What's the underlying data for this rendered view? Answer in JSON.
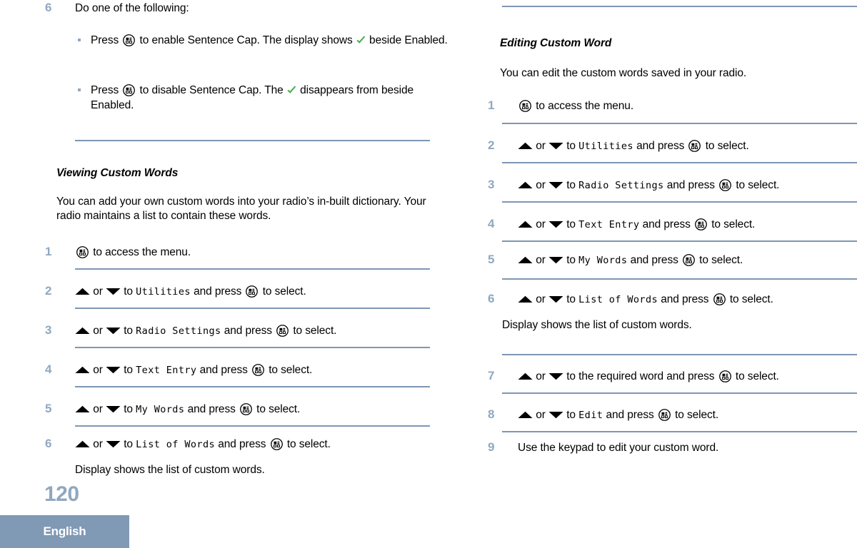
{
  "page": {
    "number": "120",
    "language": "English"
  },
  "icons": {
    "menu_button": "menu-button-icon",
    "up_arrow": "up-arrow-icon",
    "down_arrow": "down-arrow-icon",
    "checkmark": "green-checkmark-icon"
  },
  "colors": {
    "accent_rule": "#7e96b4",
    "step_number": "#8fa8c0",
    "band": "#8099b5",
    "check_green": "#4caf50",
    "bullet": "#8fa8c0"
  },
  "left_column": {
    "step6": {
      "number": "6",
      "text": "Do one of the following:",
      "bullets": [
        {
          "pre": "Press",
          "post": " to enable Sentence Cap. The display shows",
          "tail_pre": "",
          "tail_post": " beside Enabled."
        },
        {
          "pre": "Press",
          "post": " to disable Sentence Cap. The",
          "tail_pre": "",
          "tail_post": " disappears from beside Enabled."
        }
      ]
    },
    "section": {
      "title": "Viewing Custom Words",
      "intro": "You can add your own custom words into your radio’s in-built dictionary. Your radio maintains a list to contain these words.",
      "steps": [
        {
          "number": "1",
          "kind": "press-menu",
          "pre": "",
          "post": " to access the menu."
        },
        {
          "number": "2",
          "kind": "nav",
          "pre": " or ",
          "mid": " to ",
          "menu_item": "Utilities",
          "after": " and press ",
          "post": " to select."
        },
        {
          "number": "3",
          "kind": "nav",
          "pre": " or ",
          "mid": " to ",
          "menu_item": "Radio Settings",
          "after": " and press ",
          "post": " to select."
        },
        {
          "number": "4",
          "kind": "nav",
          "pre": " or ",
          "mid": " to ",
          "menu_item": "Text Entry",
          "after": " and press ",
          "post": " to select."
        },
        {
          "number": "5",
          "kind": "nav",
          "pre": " or ",
          "mid": " to ",
          "menu_item": "My Words",
          "after": " and press ",
          "post": " to select."
        },
        {
          "number": "6",
          "kind": "nav",
          "pre": " or ",
          "mid": " to ",
          "menu_item": "List of Words",
          "after": " and press ",
          "post": " to select.",
          "note": "Display shows the list of custom words."
        }
      ]
    }
  },
  "right_column": {
    "section": {
      "title": "Editing Custom Word",
      "intro": "You can edit the custom words saved in your radio.",
      "steps": [
        {
          "number": "1",
          "kind": "press-menu",
          "pre": "",
          "post": " to access the menu."
        },
        {
          "number": "2",
          "kind": "nav",
          "pre": " or ",
          "mid": " to ",
          "menu_item": "Utilities",
          "after": " and press ",
          "post": " to select."
        },
        {
          "number": "3",
          "kind": "nav",
          "pre": " or ",
          "mid": " to ",
          "menu_item": "Radio Settings",
          "after": " and press ",
          "post": " to select."
        },
        {
          "number": "4",
          "kind": "nav",
          "pre": " or ",
          "mid": " to ",
          "menu_item": "Text Entry",
          "after": " and press ",
          "post": " to select."
        },
        {
          "number": "5",
          "kind": "nav",
          "pre": " or ",
          "mid": " to ",
          "menu_item": "My Words",
          "after": " and press ",
          "post": " to select."
        },
        {
          "number": "6",
          "kind": "nav",
          "pre": " or ",
          "mid": " to ",
          "menu_item": "List of Words",
          "after": " and press ",
          "post": " to select.",
          "note": "Display shows the list of custom words."
        },
        {
          "number": "7",
          "kind": "nav-plain",
          "pre": " or ",
          "mid": " to the required word and press ",
          "post": " to select."
        },
        {
          "number": "8",
          "kind": "nav",
          "pre": " or ",
          "mid": " to ",
          "menu_item": "Edit",
          "after": " and press ",
          "post": " to select."
        },
        {
          "number": "9",
          "kind": "plain",
          "text": "Use the keypad to edit your custom word."
        }
      ]
    }
  }
}
